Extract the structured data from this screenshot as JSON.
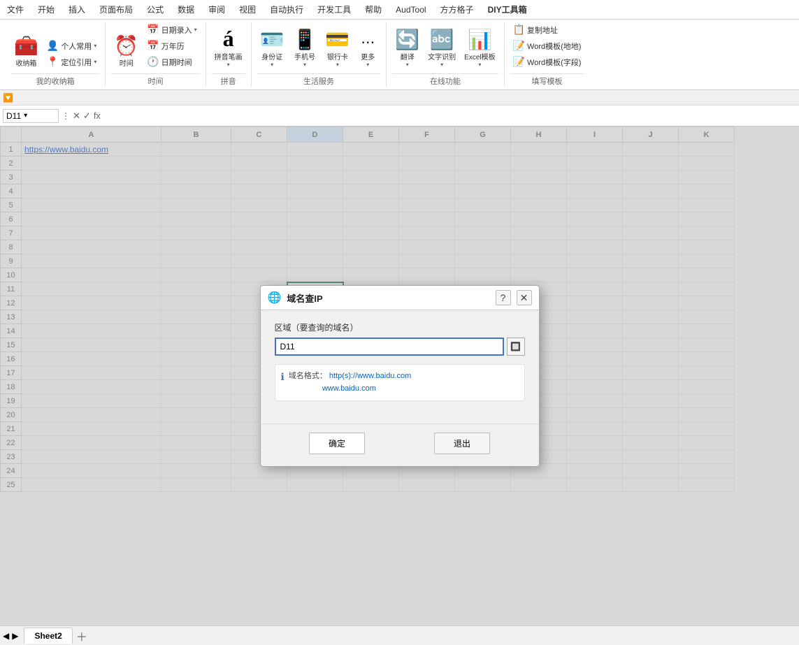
{
  "menubar": {
    "items": [
      "文件",
      "开始",
      "插入",
      "页面布局",
      "公式",
      "数据",
      "审阅",
      "视图",
      "自动执行",
      "开发工具",
      "帮助",
      "AudTool",
      "方方格子",
      "DIY工具箱"
    ]
  },
  "ribbon": {
    "groups": [
      {
        "label": "我的收纳箱",
        "items": [
          {
            "icon": "🧰",
            "label": "收纳\n箱"
          },
          {
            "icon": "👤",
            "label": "个人常\n用▾"
          },
          {
            "icon": "📍",
            "label": "定位引\n用▾"
          }
        ]
      },
      {
        "label": "时间",
        "items": [
          {
            "icon": "⏰",
            "label": "时间"
          },
          {
            "subitems": [
              "📅 日期录入▾",
              "📅 万年历",
              "🕐 日期时间"
            ]
          }
        ]
      },
      {
        "label": "拼音",
        "items": [
          {
            "icon": "á",
            "label": "拼音笔\n画▾"
          }
        ]
      },
      {
        "label": "生活服务",
        "items": [
          {
            "icon": "🪪",
            "label": "身份\n证▾"
          },
          {
            "icon": "📱",
            "label": "手机\n号▾"
          },
          {
            "icon": "💳",
            "label": "银行\n卡▾"
          },
          {
            "icon": "⋯",
            "label": "更多\n▾"
          }
        ]
      },
      {
        "label": "在线功能",
        "items": [
          {
            "icon": "🔄",
            "label": "翻译▾"
          },
          {
            "icon": "🔤",
            "label": "文字识\n别▾"
          },
          {
            "icon": "📊",
            "label": "Excel模\n板▾"
          }
        ]
      },
      {
        "label": "填写模板",
        "items": [
          {
            "icon": "📋",
            "label": "复制地址"
          },
          {
            "icon": "📝",
            "label": "Word模板(地地)"
          },
          {
            "icon": "📝",
            "label": "Word模板(字段)"
          }
        ]
      }
    ]
  },
  "formulabar": {
    "namebox": "D11",
    "formula": "fx"
  },
  "quickbar": {
    "symbol": "🔽"
  },
  "spreadsheet": {
    "columns": [
      "A",
      "B",
      "C",
      "D",
      "E",
      "F",
      "G",
      "H",
      "I",
      "J",
      "K"
    ],
    "rows": [
      {
        "num": 1,
        "A": "https://www.baidu.com",
        "isLink": true
      },
      {
        "num": 2,
        "A": ""
      },
      {
        "num": 3,
        "A": ""
      },
      {
        "num": 4,
        "A": ""
      },
      {
        "num": 5,
        "A": ""
      },
      {
        "num": 6,
        "A": ""
      },
      {
        "num": 7,
        "A": ""
      },
      {
        "num": 8,
        "A": ""
      },
      {
        "num": 9,
        "A": ""
      },
      {
        "num": 10,
        "A": ""
      },
      {
        "num": 11,
        "A": "",
        "activeD": true
      },
      {
        "num": 12,
        "A": ""
      },
      {
        "num": 13,
        "A": ""
      },
      {
        "num": 14,
        "A": ""
      },
      {
        "num": 15,
        "A": ""
      },
      {
        "num": 16,
        "A": ""
      },
      {
        "num": 17,
        "A": ""
      },
      {
        "num": 18,
        "A": ""
      },
      {
        "num": 19,
        "A": ""
      },
      {
        "num": 20,
        "A": ""
      },
      {
        "num": 21,
        "A": ""
      },
      {
        "num": 22,
        "A": ""
      },
      {
        "num": 23,
        "A": ""
      },
      {
        "num": 24,
        "A": ""
      },
      {
        "num": 25,
        "A": ""
      }
    ],
    "activeCell": "D11"
  },
  "sheettabs": {
    "tabs": [
      "Sheet2"
    ],
    "active": "Sheet2"
  },
  "modal": {
    "title": "域名查IP",
    "icon": "🌐",
    "field_label": "区域（要查询的域名）",
    "field_value": "D11",
    "field_placeholder": "D11",
    "info_label": "域名格式：",
    "info_line1": "http(s)://www.baidu.com",
    "info_line2": "www.baidu.com",
    "confirm_btn": "确定",
    "cancel_btn": "退出"
  }
}
